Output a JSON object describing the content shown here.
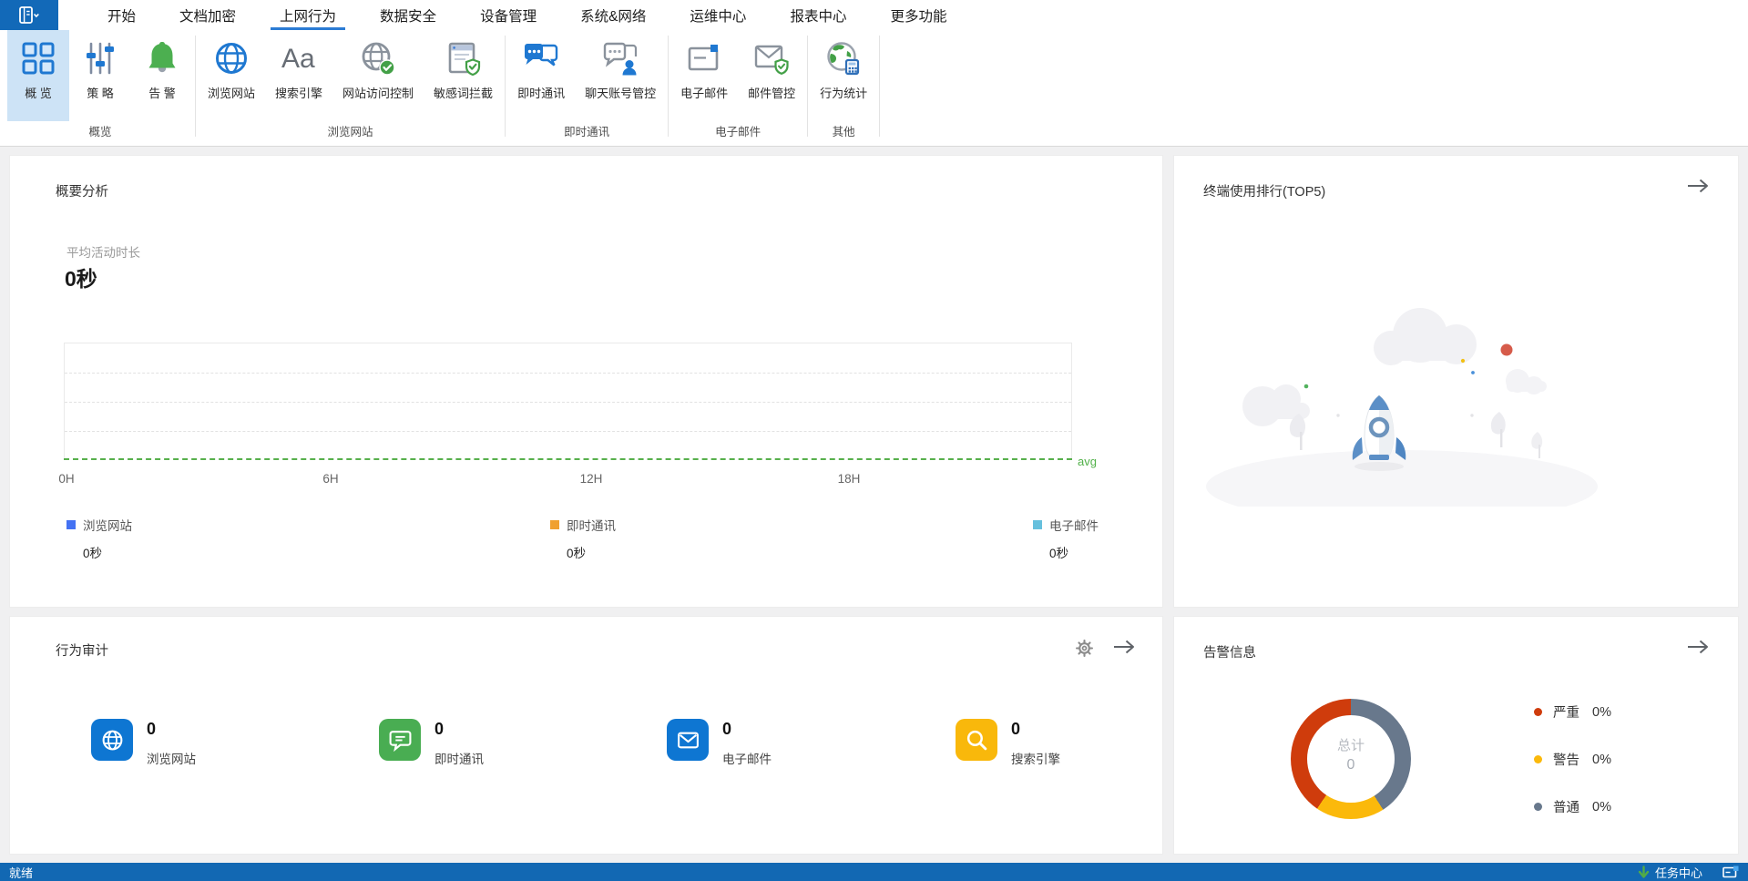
{
  "window": {
    "accent_blue": "#1269b8",
    "statusbar_blue": "#1268b3",
    "content_bg": "#f0f0f1",
    "ribbon_selected_bg": "#cde3f6",
    "tab_underline": "#2b7bd4"
  },
  "tabs": {
    "active_index": 2,
    "items": [
      {
        "label": "开始"
      },
      {
        "label": "文档加密"
      },
      {
        "label": "上网行为"
      },
      {
        "label": "数据安全"
      },
      {
        "label": "设备管理"
      },
      {
        "label": "系统&网络"
      },
      {
        "label": "运维中心"
      },
      {
        "label": "报表中心"
      },
      {
        "label": "更多功能"
      }
    ]
  },
  "ribbon": {
    "groups": [
      {
        "label": "概览",
        "items": [
          {
            "label": "概 览",
            "icon": "overview-grid-icon",
            "selected": true
          },
          {
            "label": "策 略",
            "icon": "policy-sliders-icon",
            "selected": false
          },
          {
            "label": "告 警",
            "icon": "alert-bell-icon",
            "selected": false
          }
        ]
      },
      {
        "label": "浏览网站",
        "items": [
          {
            "label": "浏览网站",
            "icon": "browse-globe-icon",
            "selected": false
          },
          {
            "label": "搜索引擎",
            "icon": "search-engine-aa-icon",
            "selected": false
          },
          {
            "label": "网站访问控制",
            "icon": "site-access-globe-check-icon",
            "selected": false
          },
          {
            "label": "敏感词拦截",
            "icon": "sensitive-word-page-shield-icon",
            "selected": false
          }
        ]
      },
      {
        "label": "即时通讯",
        "items": [
          {
            "label": "即时通讯",
            "icon": "im-chat-icon",
            "selected": false
          },
          {
            "label": "聊天账号管控",
            "icon": "chat-account-user-icon",
            "selected": false
          }
        ]
      },
      {
        "label": "电子邮件",
        "items": [
          {
            "label": "电子邮件",
            "icon": "email-envelope-icon",
            "selected": false
          },
          {
            "label": "邮件管控",
            "icon": "mail-control-shield-icon",
            "selected": false
          }
        ]
      },
      {
        "label": "其他",
        "items": [
          {
            "label": "行为统计",
            "icon": "behavior-stats-globe-icon",
            "selected": false
          }
        ]
      }
    ]
  },
  "panels": {
    "summary": {
      "title": "概要分析",
      "metric_label": "平均活动时长",
      "metric_value": "0秒"
    },
    "ranking": {
      "title": "终端使用排行(TOP5)",
      "empty_state": "rocket-illustration"
    },
    "audit": {
      "title": "行为审计",
      "stats": [
        {
          "label": "浏览网站",
          "value": "0",
          "color": "#0e76d2",
          "icon": "globe-icon"
        },
        {
          "label": "即时通讯",
          "value": "0",
          "color": "#49ad52",
          "icon": "chat-bubble-icon"
        },
        {
          "label": "电子邮件",
          "value": "0",
          "color": "#0e76d2",
          "icon": "envelope-icon"
        },
        {
          "label": "搜索引擎",
          "value": "0",
          "color": "#f9b80b",
          "icon": "magnifier-icon"
        }
      ]
    },
    "alerts": {
      "title": "告警信息"
    }
  },
  "chart_data": [
    {
      "id": "summary-activity",
      "type": "line",
      "panel": "概要分析",
      "x_ticks": [
        "0H",
        "6H",
        "12H",
        "18H"
      ],
      "x_range_hours": [
        0,
        24
      ],
      "grid": "3 dashed horizontal gridlines",
      "avg_line_label": "avg",
      "avg_line_value": 0,
      "series": [
        {
          "name": "浏览网站",
          "color": "#4472f3",
          "value_label": "0秒",
          "values": []
        },
        {
          "name": "即时通讯",
          "color": "#f0a02f",
          "value_label": "0秒",
          "values": []
        },
        {
          "name": "电子邮件",
          "color": "#66c0dd",
          "value_label": "0秒",
          "values": []
        }
      ],
      "note": "no data plotted; all series at 0"
    },
    {
      "id": "alerts-donut",
      "type": "pie",
      "panel": "告警信息",
      "center_label": "总计",
      "center_value": "0",
      "legend_position": "right",
      "legend": [
        {
          "label": "严重",
          "value": "0%",
          "color": "#cf3c0c"
        },
        {
          "label": "警告",
          "value": "0%",
          "color": "#fbb90b"
        },
        {
          "label": "普通",
          "value": "0%",
          "color": "#68788c"
        }
      ],
      "drawn_segments": [
        {
          "color": "#68788c",
          "from_pct": 0,
          "to_pct": 41
        },
        {
          "color": "#fbb90b",
          "from_pct": 41,
          "to_pct": 59.5
        },
        {
          "color": "#cf3c0c",
          "from_pct": 59.5,
          "to_pct": 100
        }
      ]
    }
  ],
  "statusbar": {
    "ready_label": "就绪",
    "task_center_label": "任务中心"
  }
}
